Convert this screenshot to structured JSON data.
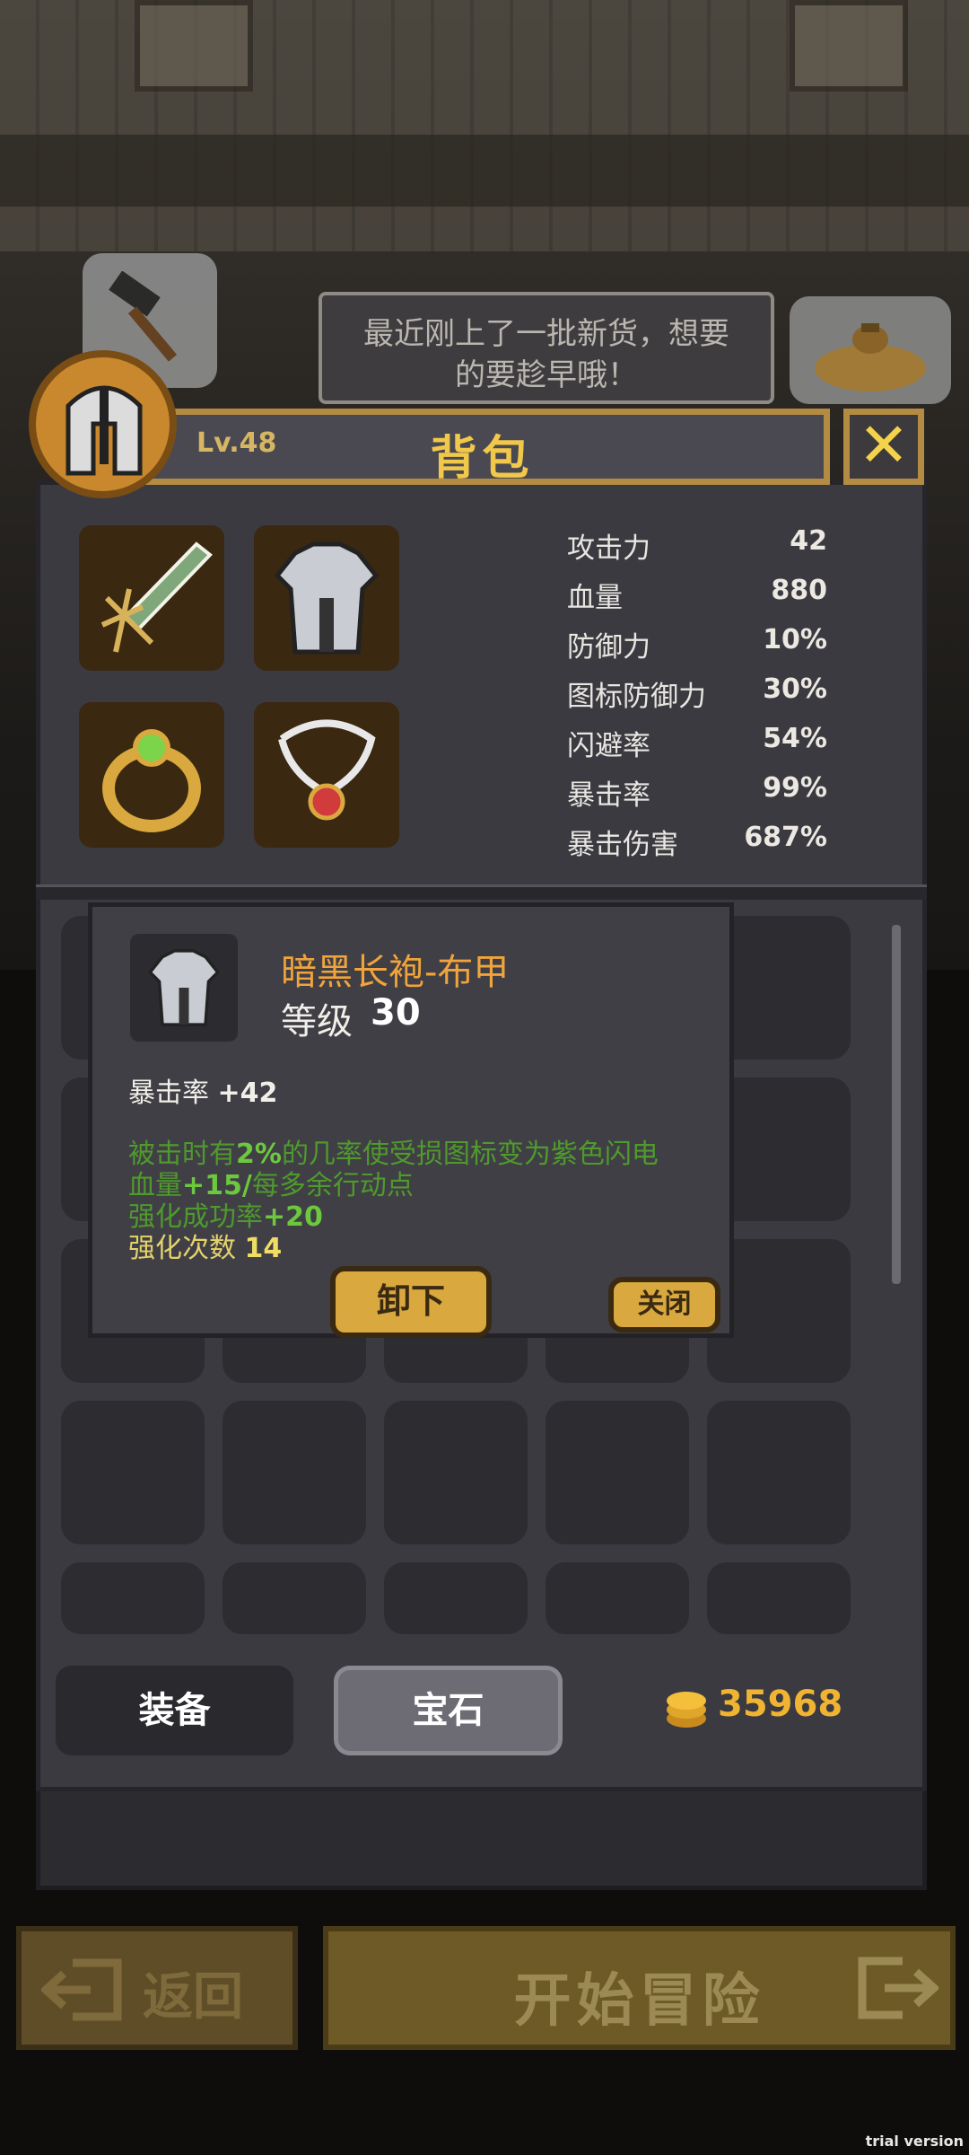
{
  "bubble": {
    "text_line1": "最近刚上了一批新货，想要",
    "text_line2": "的要趁早哦！"
  },
  "header": {
    "level": "Lv.48",
    "title": "背包",
    "close_glyph": "✕"
  },
  "equipped_slots": [
    {
      "name": "weapon",
      "icon": "sword-icon"
    },
    {
      "name": "armor",
      "icon": "armor-icon"
    },
    {
      "name": "ring",
      "icon": "ring-icon"
    },
    {
      "name": "necklace",
      "icon": "necklace-icon"
    }
  ],
  "stats": [
    {
      "label": "攻击力",
      "value": "42"
    },
    {
      "label": "血量",
      "value": "880"
    },
    {
      "label": "防御力",
      "value": "10%"
    },
    {
      "label": "图标防御力",
      "value": "30%"
    },
    {
      "label": "闪避率",
      "value": "54%"
    },
    {
      "label": "暴击率",
      "value": "99%"
    },
    {
      "label": "暴击伤害",
      "value": "687%"
    }
  ],
  "popup": {
    "item_name": "暗黑长袍-布甲",
    "level_label": "等级",
    "level_value": "30",
    "main_stat_label": "暴击率",
    "main_stat_value": "+42",
    "effect1_pre": "被击时有",
    "effect1_hl": "2%",
    "effect1_post": "的几率使受损图标变为紫色闪电",
    "effect2_pre": "血量",
    "effect2_hl": "+15/",
    "effect2_post": "每多余行动点",
    "effect3_pre": "强化成功率",
    "effect3_hl": "+20",
    "enhance_label": "强化次数",
    "enhance_value": "14",
    "unequip_label": "卸下",
    "close_label": "关闭"
  },
  "tabs": {
    "equip": "装备",
    "gem": "宝石"
  },
  "gold": "35968",
  "footer": {
    "back_label": "返回",
    "start_label": "开始冒险"
  },
  "watermark": "trial version",
  "colors": {
    "panel": "#3b3a41",
    "gold_border": "#b48b42",
    "title_text": "#f1c84a",
    "item_name": "#f0a43b",
    "effect_green": "#4f9a2c"
  }
}
